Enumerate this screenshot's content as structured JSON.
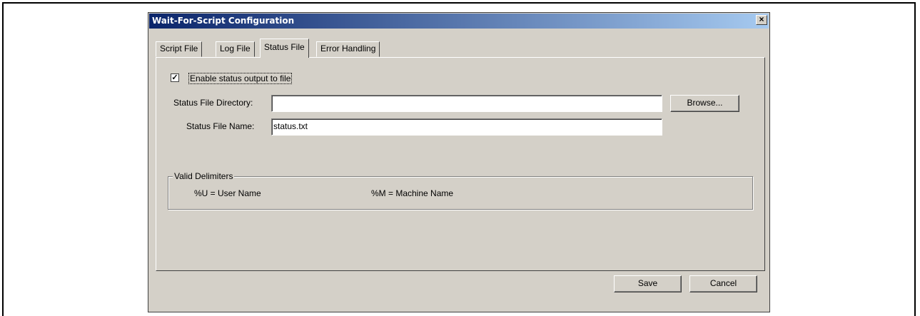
{
  "dialog": {
    "title": "Wait-For-Script Configuration",
    "close_glyph": "×"
  },
  "tabs": [
    {
      "label": "Script File",
      "active": false
    },
    {
      "label": "Log File",
      "active": false
    },
    {
      "label": "Status File",
      "active": true
    },
    {
      "label": "Error Handling",
      "active": false
    }
  ],
  "status_panel": {
    "enable_checkbox": {
      "checked": true,
      "glyph": "✓",
      "label": "Enable status output to file"
    },
    "directory": {
      "label": "Status File Directory:",
      "value": ""
    },
    "browse_label": "Browse...",
    "file_name": {
      "label": "Status File Name:",
      "value": "status.txt"
    },
    "delimiters": {
      "title": "Valid Delimiters",
      "user": "%U = User Name",
      "machine": "%M = Machine Name"
    }
  },
  "footer": {
    "save_label": "Save",
    "cancel_label": "Cancel"
  }
}
